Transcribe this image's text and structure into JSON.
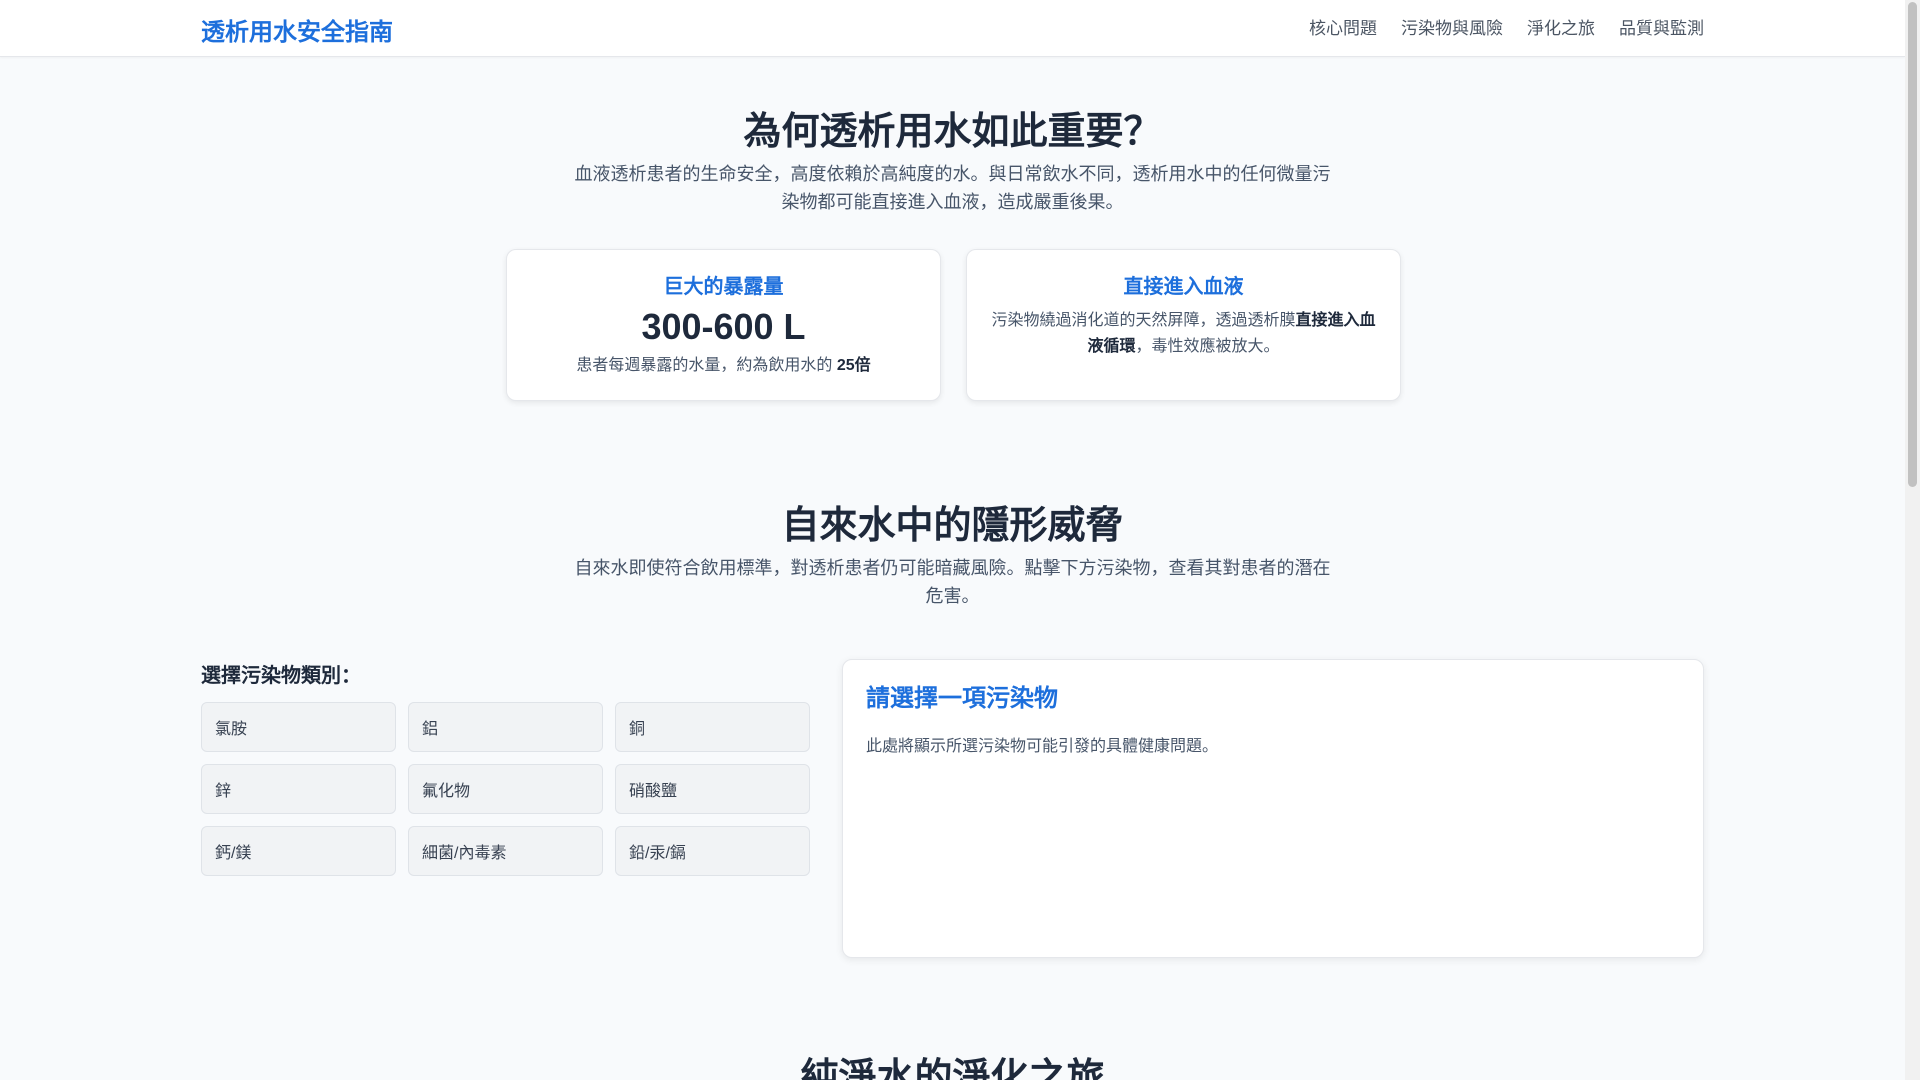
{
  "header": {
    "brand": "透析用水安全指南",
    "nav": [
      "核心問題",
      "污染物與風險",
      "淨化之旅",
      "品質與監測"
    ]
  },
  "why": {
    "title": "為何透析用水如此重要？",
    "desc": "血液透析患者的生命安全，高度依賴於高純度的水。與日常飲水不同，透析用水中的任何微量污染物都可能直接進入血液，造成嚴重後果。",
    "cards": [
      {
        "title": "巨大的暴露量",
        "value": "300-600 L",
        "note_pre": "患者每週暴露的水量，約為飲用水的 ",
        "note_bold": "25倍",
        "note_post": ""
      },
      {
        "title": "直接進入血液",
        "value": "",
        "note_pre": "污染物繞過消化道的天然屏障，透過透析膜",
        "note_bold": "直接進入血液循環",
        "note_post": "，毒性效應被放大。"
      }
    ]
  },
  "threats": {
    "title": "自來水中的隱形威脅",
    "desc": "自來水即使符合飲用標準，對透析患者仍可能暗藏風險。點擊下方污染物，查看其對患者的潛在危害。",
    "select_label": "選擇污染物類別：",
    "pollutants": [
      "氯胺",
      "鋁",
      "銅",
      "鋅",
      "氟化物",
      "硝酸鹽",
      "鈣/鎂",
      "細菌/內毒素",
      "鉛/汞/鎘"
    ],
    "detail": {
      "title": "請選擇一項污染物",
      "text": "此處將顯示所選污染物可能引發的具體健康問題。"
    }
  },
  "journey": {
    "title": "純淨水的淨化之旅"
  }
}
